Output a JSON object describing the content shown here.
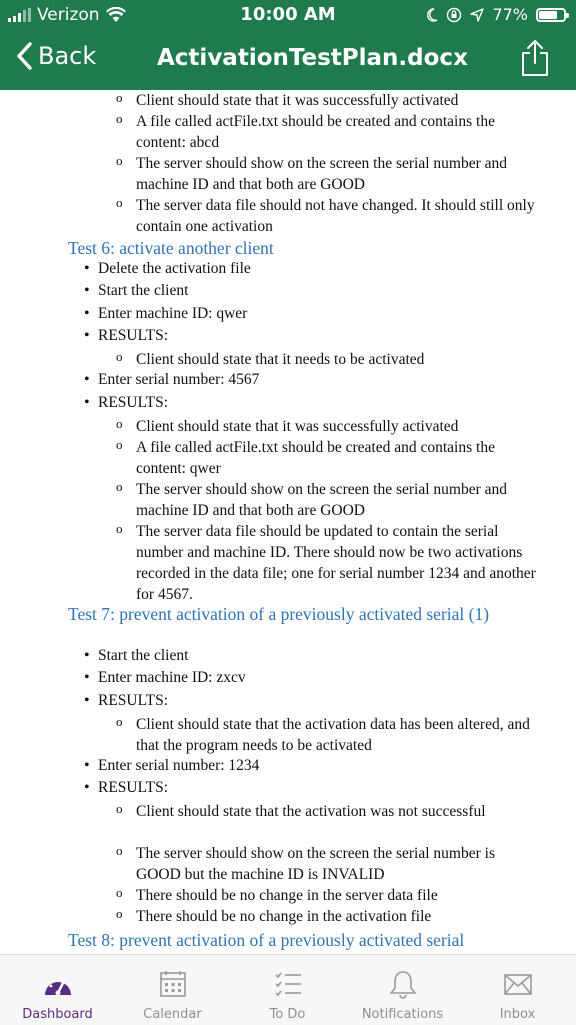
{
  "status_bar": {
    "carrier": "Verizon",
    "time": "10:00 AM",
    "battery_percent_text": "77%",
    "battery_level": 0.77
  },
  "nav": {
    "back_label": "Back",
    "title": "ActivationTestPlan.docx",
    "share_icon": "share-icon"
  },
  "document": {
    "intro_subitems": [
      "Client should state that it was successfully activated",
      "A file called actFile.txt should be created and contains the content: abcd",
      "The server should show on the screen the serial number and machine ID and that both are GOOD",
      "The server data file should not have changed. It should still only contain one activation"
    ],
    "test6": {
      "heading": "Test 6: activate another client",
      "bullets": [
        "Delete the activation file",
        "Start the client",
        "Enter machine ID: qwer",
        "RESULTS:",
        "Enter serial number: 4567",
        "RESULTS:"
      ],
      "results1": [
        "Client should state that it needs to be activated"
      ],
      "results2": [
        "Client should state that it was successfully activated",
        "A file called actFile.txt should be created and contains the content: qwer",
        "The server should show on the screen the serial number and machine ID and that both are GOOD",
        "The server data file should be updated to contain the serial number and machine ID. There should now be two activations recorded in the data file; one for serial number 1234 and another for 4567."
      ]
    },
    "test7": {
      "heading": "Test 7: prevent activation of a previously activated serial (1)",
      "bullets": [
        "Start the client",
        "Enter machine ID: zxcv",
        "RESULTS:",
        "Enter serial number: 1234",
        "RESULTS:"
      ],
      "results1": [
        "Client should state that the activation data has been altered, and that the program needs to be activated"
      ],
      "results2": [
        "Client should state that the activation was not successful",
        "The server should show on the screen the serial number is GOOD but the machine ID is INVALID",
        "There should be no change in the server data file",
        "There should be no change in the activation file"
      ]
    },
    "test8": {
      "heading": "Test 8: prevent activation of a previously activated serial"
    }
  },
  "tab_bar": {
    "accent_color": "#5b2c83",
    "tabs": [
      {
        "label": "Dashboard",
        "icon": "dashboard-icon",
        "active": true
      },
      {
        "label": "Calendar",
        "icon": "calendar-icon",
        "active": false
      },
      {
        "label": "To Do",
        "icon": "todo-list-icon",
        "active": false
      },
      {
        "label": "Notifications",
        "icon": "bell-icon",
        "active": false
      },
      {
        "label": "Inbox",
        "icon": "envelope-icon",
        "active": false
      }
    ]
  }
}
